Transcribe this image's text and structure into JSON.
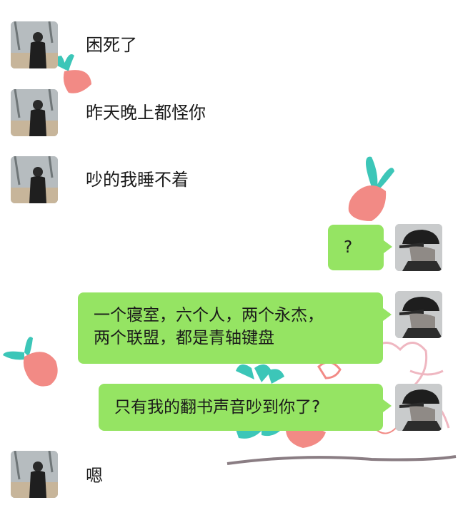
{
  "chat": {
    "incoming_1": "困死了",
    "incoming_2": "昨天晚上都怪你",
    "incoming_3": "吵的我睡不着",
    "outgoing_1": "?",
    "outgoing_2_line1": "一个寝室，六个人，两个永杰，",
    "outgoing_2_line2": "两个联盟，都是青轴键盘",
    "outgoing_3": "只有我的翻书声音吵到你了?",
    "incoming_4": "嗯"
  },
  "icons": {
    "contact_avatar": "person-on-beach-avatar-icon",
    "self_avatar": "man-in-cap-avatar-icon",
    "decoration": "carrot-doodle-icon"
  },
  "colors": {
    "bubble_green": "#95e463",
    "carrot_pink": "#f28a85",
    "carrot_leaf": "#3cc6b8"
  }
}
